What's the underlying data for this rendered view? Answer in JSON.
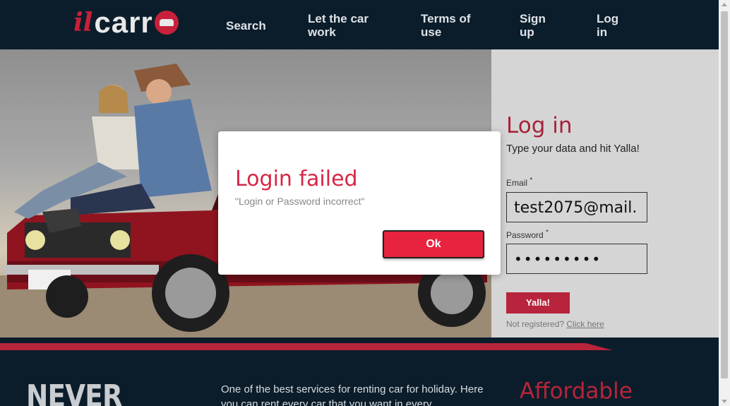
{
  "header": {
    "logo_text": "ilcarro",
    "nav": {
      "search": "Search",
      "let_car_work": "Let the car work",
      "terms": "Terms of use",
      "signup": "Sign up",
      "login": "Log in"
    }
  },
  "login_panel": {
    "title": "Log in",
    "subtitle": "Type your data and hit Yalla!",
    "email_label": "Email",
    "email_value": "test2075@mail.",
    "password_label": "Password",
    "password_value": "•••••••••",
    "required_mark": "*",
    "submit_label": "Yalla!",
    "not_registered": "Not registered?",
    "click_here": "Click here"
  },
  "bottom": {
    "never": "NEVER",
    "text": "One of the best services for renting car for holiday. Here you can rent every car that you want in every",
    "affordable": "Affordable"
  },
  "modal": {
    "title": "Login failed",
    "message": "\"Login or Password incorrect\"",
    "ok_label": "Ok"
  },
  "colors": {
    "header_bg": "#0b1d2a",
    "accent_red": "#b8243b",
    "modal_red": "#e8233f"
  }
}
